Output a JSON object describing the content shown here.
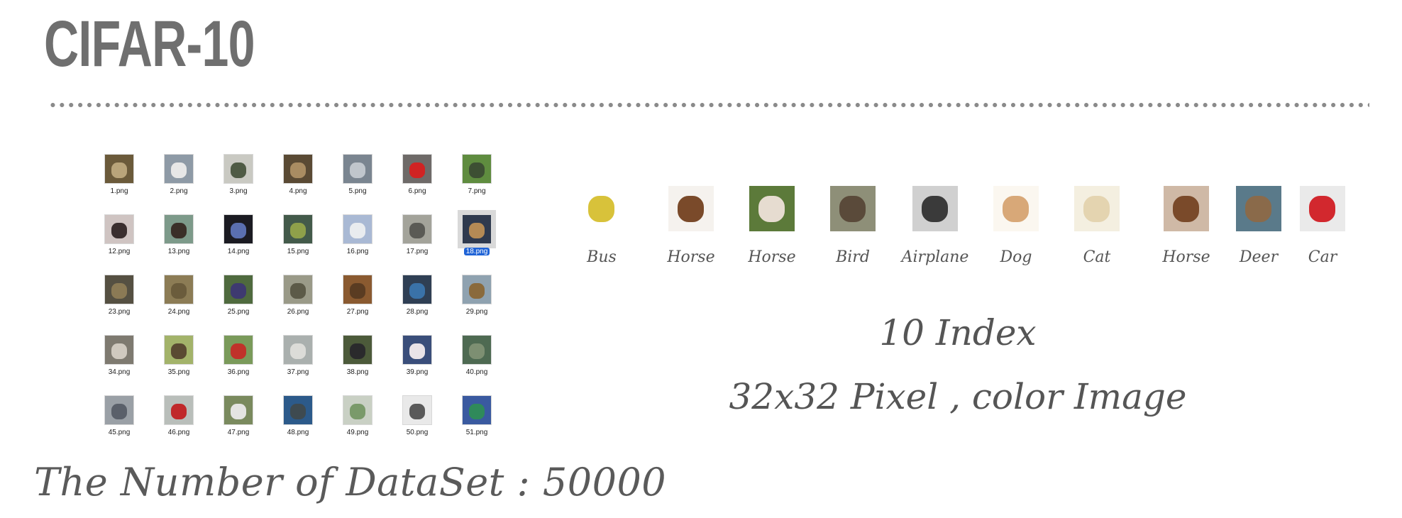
{
  "title": "CIFAR-10",
  "grid": {
    "files": [
      {
        "name": "1.png",
        "c1": "#6b5a3a",
        "c2": "#b9a47a"
      },
      {
        "name": "2.png",
        "c1": "#8e9aa6",
        "c2": "#e7e7e7"
      },
      {
        "name": "3.png",
        "c1": "#c9c9c2",
        "c2": "#4f5b45"
      },
      {
        "name": "4.png",
        "c1": "#5a4a34",
        "c2": "#a98c62"
      },
      {
        "name": "5.png",
        "c1": "#7a8590",
        "c2": "#c0c6cc"
      },
      {
        "name": "6.png",
        "c1": "#6e6a68",
        "c2": "#d02323"
      },
      {
        "name": "7.png",
        "c1": "#5f8c3f",
        "c2": "#3d4f33"
      },
      {
        "name": "12.png",
        "c1": "#cfc4c2",
        "c2": "#3a2f2f"
      },
      {
        "name": "13.png",
        "c1": "#7d9a8a",
        "c2": "#3a2f28"
      },
      {
        "name": "14.png",
        "c1": "#1b1b22",
        "c2": "#5a6fb0"
      },
      {
        "name": "15.png",
        "c1": "#435a4a",
        "c2": "#8fa04a"
      },
      {
        "name": "16.png",
        "c1": "#a9b9d4",
        "c2": "#e9ecef"
      },
      {
        "name": "17.png",
        "c1": "#a3a39a",
        "c2": "#5a5a55"
      },
      {
        "name": "18.png",
        "c1": "#2f3a4e",
        "c2": "#b48a55"
      },
      {
        "name": "23.png",
        "c1": "#555042",
        "c2": "#8b7a55"
      },
      {
        "name": "24.png",
        "c1": "#8c7c55",
        "c2": "#6b5c3c"
      },
      {
        "name": "25.png",
        "c1": "#4f6a3e",
        "c2": "#3e3a70"
      },
      {
        "name": "26.png",
        "c1": "#9a9a88",
        "c2": "#5c5a48"
      },
      {
        "name": "27.png",
        "c1": "#8a5a30",
        "c2": "#5a3c22"
      },
      {
        "name": "28.png",
        "c1": "#2f3f54",
        "c2": "#3a72a8"
      },
      {
        "name": "29.png",
        "c1": "#8fa2b0",
        "c2": "#8a6a3c"
      },
      {
        "name": "34.png",
        "c1": "#7e7a70",
        "c2": "#cfc9bf"
      },
      {
        "name": "35.png",
        "c1": "#a3b36a",
        "c2": "#5a4a32"
      },
      {
        "name": "36.png",
        "c1": "#7a9a5a",
        "c2": "#c0322a"
      },
      {
        "name": "37.png",
        "c1": "#aab0ae",
        "c2": "#dcdcd8"
      },
      {
        "name": "38.png",
        "c1": "#4c5a3a",
        "c2": "#2a2a2c"
      },
      {
        "name": "39.png",
        "c1": "#3a4e7a",
        "c2": "#e9e3e7"
      },
      {
        "name": "40.png",
        "c1": "#4e6a52",
        "c2": "#7d8f72"
      },
      {
        "name": "45.png",
        "c1": "#9aa0a6",
        "c2": "#5a606a"
      },
      {
        "name": "46.png",
        "c1": "#b9beba",
        "c2": "#c0282a"
      },
      {
        "name": "47.png",
        "c1": "#7a8a5e",
        "c2": "#e4e4e2"
      },
      {
        "name": "48.png",
        "c1": "#2c5a8a",
        "c2": "#3e4a50"
      },
      {
        "name": "49.png",
        "c1": "#c9d0c4",
        "c2": "#7a9a6a"
      },
      {
        "name": "50.png",
        "c1": "#e9e9e9",
        "c2": "#5a5a5a"
      },
      {
        "name": "51.png",
        "c1": "#3a5aa0",
        "c2": "#2f8a5a"
      }
    ],
    "selected_index": 13
  },
  "footer": "The Number of DataSet : 50000",
  "samples": [
    {
      "label": "Bus",
      "c1": "#ffffff",
      "c2": "#d8c23a"
    },
    {
      "label": "Horse",
      "c1": "#f5f2ee",
      "c2": "#7a4a2a"
    },
    {
      "label": "Horse",
      "c1": "#5c7a3a",
      "c2": "#e6dcd0"
    },
    {
      "label": "Bird",
      "c1": "#8e8f78",
      "c2": "#5a4a3a"
    },
    {
      "label": "Airplane",
      "c1": "#d0d0d0",
      "c2": "#3a3a3a"
    },
    {
      "label": "Dog",
      "c1": "#fbf7f0",
      "c2": "#d8a878"
    },
    {
      "label": "Cat",
      "c1": "#f4efe0",
      "c2": "#e4d4b0"
    },
    {
      "label": "Horse",
      "c1": "#cfb9a6",
      "c2": "#7a4a2a"
    },
    {
      "label": "Deer",
      "c1": "#5a7a8a",
      "c2": "#8a6a4a"
    },
    {
      "label": "Car",
      "c1": "#eaeaea",
      "c2": "#d2282e"
    }
  ],
  "info": {
    "line1": "10 Index",
    "line2": "32x32 Pixel , color Image"
  }
}
